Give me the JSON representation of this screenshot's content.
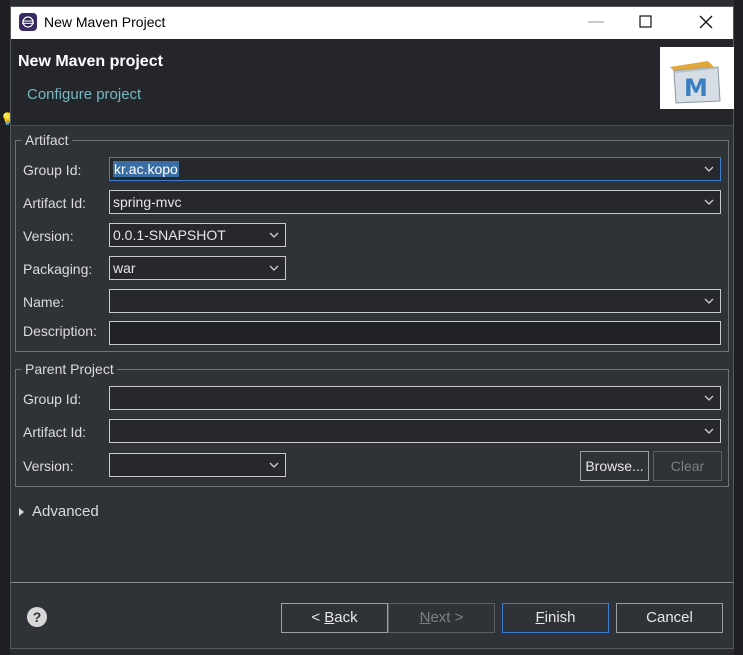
{
  "window": {
    "title": "New Maven Project"
  },
  "header": {
    "title": "New Maven project",
    "subtitle": "Configure project",
    "logo_letter": "M"
  },
  "artifact": {
    "legend": "Artifact",
    "group_id_label": "Group Id:",
    "group_id_value": "kr.ac.kopo",
    "artifact_id_label": "Artifact Id:",
    "artifact_id_value": "spring-mvc",
    "version_label": "Version:",
    "version_value": "0.0.1-SNAPSHOT",
    "packaging_label": "Packaging:",
    "packaging_value": "war",
    "name_label": "Name:",
    "name_value": "",
    "description_label": "Description:",
    "description_value": ""
  },
  "parent": {
    "legend": "Parent Project",
    "group_id_label": "Group Id:",
    "group_id_value": "",
    "artifact_id_label": "Artifact Id:",
    "artifact_id_value": "",
    "version_label": "Version:",
    "version_value": "",
    "browse_label": "Browse...",
    "clear_label": "Clear"
  },
  "advanced_label": "Advanced",
  "buttons": {
    "back_prefix": "< ",
    "back_mnemonic": "B",
    "back_rest": "ack",
    "next_mnemonic": "N",
    "next_rest": "ext >",
    "finish_mnemonic": "F",
    "finish_rest": "inish",
    "cancel": "Cancel"
  },
  "icons": {
    "app": "eclipse-icon",
    "help": "help-icon",
    "dropdown": "chevron-down-icon"
  },
  "colors": {
    "background": "#2f3237",
    "header": "#24262b",
    "accent_focus": "#3c7ed1",
    "subtitle": "#79b8c0",
    "selection": "#3a6ea5"
  }
}
